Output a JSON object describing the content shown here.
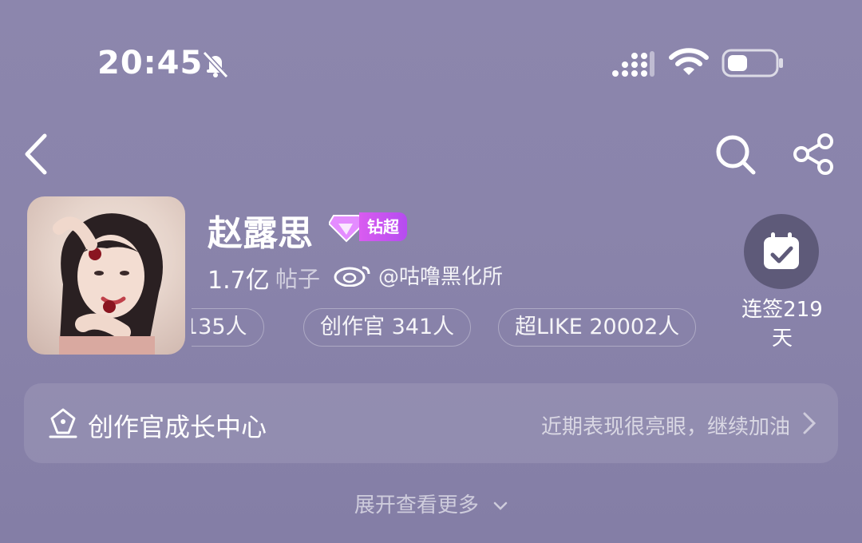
{
  "status_bar": {
    "time": "20:45"
  },
  "profile": {
    "name": "赵露思",
    "badge": "钻超",
    "posts_count": "1.7亿",
    "posts_label": "帖子",
    "watermark": "@咕噜黑化所",
    "chips": [
      "135人",
      "创作官 341人",
      "超LIKE 20002人"
    ],
    "checkin": "连签219天"
  },
  "growth_center": {
    "title": "创作官成长中心",
    "subtitle": "近期表现很亮眼，继续加油"
  },
  "expand_more": "展开查看更多",
  "colors": {
    "background": "#8a84ab",
    "badge": "#c855f0",
    "checkin_circle": "#5e5a79"
  }
}
